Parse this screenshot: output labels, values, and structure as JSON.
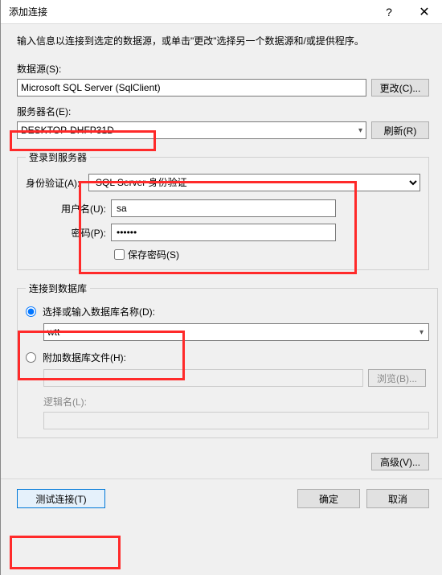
{
  "titlebar": {
    "title": "添加连接",
    "help": "?",
    "close": "✕"
  },
  "instruction": "输入信息以连接到选定的数据源，或单击\"更改\"选择另一个数据源和/或提供程序。",
  "datasource": {
    "label": "数据源(S):",
    "value": "Microsoft SQL Server (SqlClient)",
    "change_btn": "更改(C)..."
  },
  "server": {
    "label": "服务器名(E):",
    "value": "DESKTOP-DHFP31D",
    "refresh_btn": "刷新(R)"
  },
  "login_group": {
    "legend": "登录到服务器",
    "auth_label": "身份验证(A):",
    "auth_value": "SQL Server 身份验证",
    "user_label": "用户名(U):",
    "user_value": "sa",
    "pass_label": "密码(P):",
    "pass_value": "••••••",
    "save_pass_label": "保存密码(S)"
  },
  "db_group": {
    "legend": "连接到数据库",
    "radio_select_label": "选择或输入数据库名称(D):",
    "db_value": "wtt",
    "radio_attach_label": "附加数据库文件(H):",
    "browse_btn": "浏览(B)...",
    "logic_label": "逻辑名(L):"
  },
  "buttons": {
    "advanced": "高级(V)...",
    "test": "测试连接(T)",
    "ok": "确定",
    "cancel": "取消"
  }
}
